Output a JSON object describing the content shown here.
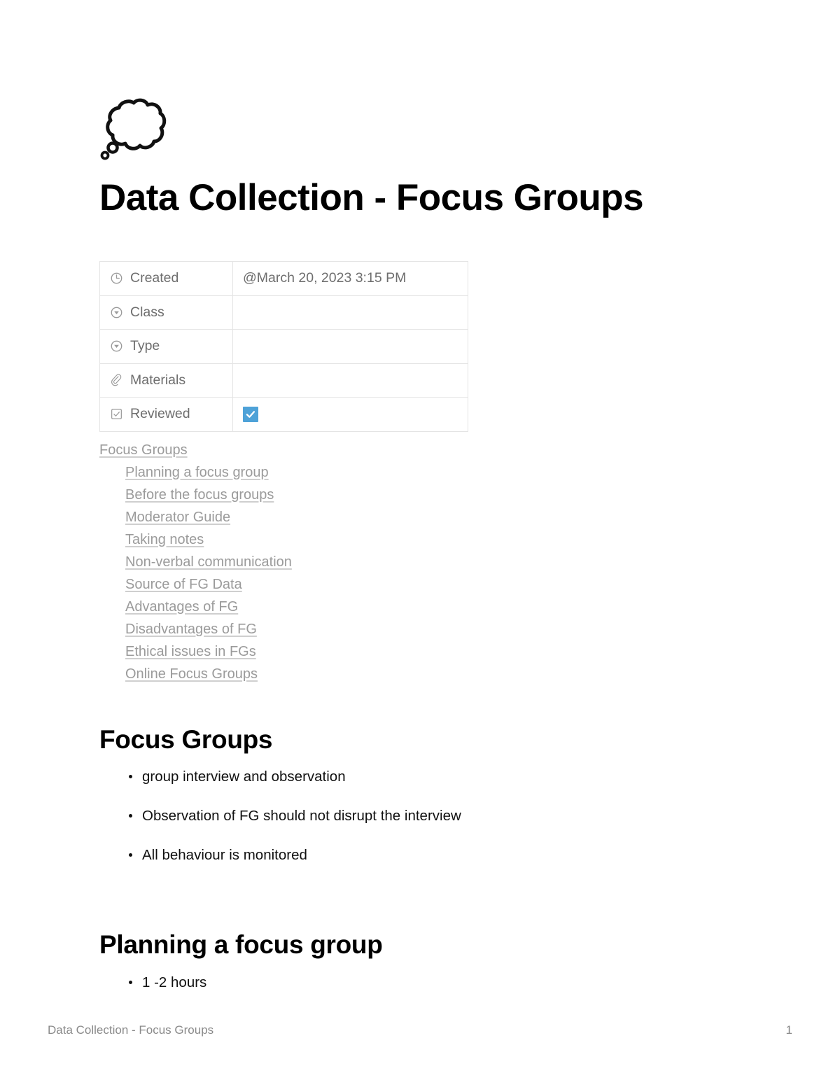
{
  "document": {
    "emoji_icon": "thought-balloon-icon",
    "title": "Data Collection - Focus Groups"
  },
  "properties": {
    "rows": [
      {
        "icon": "clock-icon",
        "label": "Created",
        "value": "@March 20, 2023 3:15 PM",
        "type": "text"
      },
      {
        "icon": "select-circle-icon",
        "label": "Class",
        "value": "",
        "type": "text"
      },
      {
        "icon": "select-circle-icon",
        "label": "Type",
        "value": "",
        "type": "text"
      },
      {
        "icon": "paperclip-icon",
        "label": "Materials",
        "value": "",
        "type": "text"
      },
      {
        "icon": "checkbox-icon",
        "label": "Reviewed",
        "value": "checked",
        "type": "checkbox"
      }
    ],
    "checkbox_color": "#4ea2d8"
  },
  "table_of_contents": [
    {
      "label": "Focus Groups",
      "level": 1
    },
    {
      "label": "Planning a focus group",
      "level": 2
    },
    {
      "label": "Before the focus groups",
      "level": 2
    },
    {
      "label": "Moderator Guide",
      "level": 2
    },
    {
      "label": "Taking notes",
      "level": 2
    },
    {
      "label": "Non-verbal communication",
      "level": 2
    },
    {
      "label": "Source of FG Data",
      "level": 2
    },
    {
      "label": "Advantages of FG",
      "level": 2
    },
    {
      "label": "Disadvantages of FG",
      "level": 2
    },
    {
      "label": "Ethical issues in FGs",
      "level": 2
    },
    {
      "label": "Online Focus Groups",
      "level": 2
    }
  ],
  "sections": [
    {
      "heading": "Focus Groups",
      "bullets": [
        "group interview and observation",
        "Observation of FG should not disrupt the interview",
        "All behaviour is monitored"
      ]
    },
    {
      "heading": "Planning a focus group",
      "bullets": [
        "1 -2 hours"
      ]
    }
  ],
  "footer": {
    "left": "Data Collection - Focus Groups",
    "page_number": "1"
  }
}
